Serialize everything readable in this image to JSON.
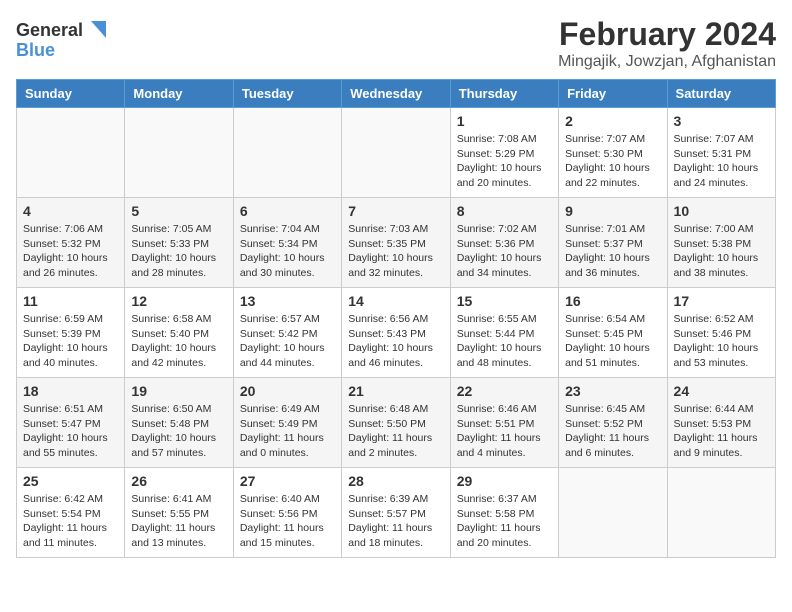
{
  "logo": {
    "text_general": "General",
    "text_blue": "Blue"
  },
  "title": "February 2024",
  "subtitle": "Mingajik, Jowzjan, Afghanistan",
  "days_of_week": [
    "Sunday",
    "Monday",
    "Tuesday",
    "Wednesday",
    "Thursday",
    "Friday",
    "Saturday"
  ],
  "weeks": [
    [
      {
        "day": "",
        "info": ""
      },
      {
        "day": "",
        "info": ""
      },
      {
        "day": "",
        "info": ""
      },
      {
        "day": "",
        "info": ""
      },
      {
        "day": "1",
        "info": "Sunrise: 7:08 AM\nSunset: 5:29 PM\nDaylight: 10 hours\nand 20 minutes."
      },
      {
        "day": "2",
        "info": "Sunrise: 7:07 AM\nSunset: 5:30 PM\nDaylight: 10 hours\nand 22 minutes."
      },
      {
        "day": "3",
        "info": "Sunrise: 7:07 AM\nSunset: 5:31 PM\nDaylight: 10 hours\nand 24 minutes."
      }
    ],
    [
      {
        "day": "4",
        "info": "Sunrise: 7:06 AM\nSunset: 5:32 PM\nDaylight: 10 hours\nand 26 minutes."
      },
      {
        "day": "5",
        "info": "Sunrise: 7:05 AM\nSunset: 5:33 PM\nDaylight: 10 hours\nand 28 minutes."
      },
      {
        "day": "6",
        "info": "Sunrise: 7:04 AM\nSunset: 5:34 PM\nDaylight: 10 hours\nand 30 minutes."
      },
      {
        "day": "7",
        "info": "Sunrise: 7:03 AM\nSunset: 5:35 PM\nDaylight: 10 hours\nand 32 minutes."
      },
      {
        "day": "8",
        "info": "Sunrise: 7:02 AM\nSunset: 5:36 PM\nDaylight: 10 hours\nand 34 minutes."
      },
      {
        "day": "9",
        "info": "Sunrise: 7:01 AM\nSunset: 5:37 PM\nDaylight: 10 hours\nand 36 minutes."
      },
      {
        "day": "10",
        "info": "Sunrise: 7:00 AM\nSunset: 5:38 PM\nDaylight: 10 hours\nand 38 minutes."
      }
    ],
    [
      {
        "day": "11",
        "info": "Sunrise: 6:59 AM\nSunset: 5:39 PM\nDaylight: 10 hours\nand 40 minutes."
      },
      {
        "day": "12",
        "info": "Sunrise: 6:58 AM\nSunset: 5:40 PM\nDaylight: 10 hours\nand 42 minutes."
      },
      {
        "day": "13",
        "info": "Sunrise: 6:57 AM\nSunset: 5:42 PM\nDaylight: 10 hours\nand 44 minutes."
      },
      {
        "day": "14",
        "info": "Sunrise: 6:56 AM\nSunset: 5:43 PM\nDaylight: 10 hours\nand 46 minutes."
      },
      {
        "day": "15",
        "info": "Sunrise: 6:55 AM\nSunset: 5:44 PM\nDaylight: 10 hours\nand 48 minutes."
      },
      {
        "day": "16",
        "info": "Sunrise: 6:54 AM\nSunset: 5:45 PM\nDaylight: 10 hours\nand 51 minutes."
      },
      {
        "day": "17",
        "info": "Sunrise: 6:52 AM\nSunset: 5:46 PM\nDaylight: 10 hours\nand 53 minutes."
      }
    ],
    [
      {
        "day": "18",
        "info": "Sunrise: 6:51 AM\nSunset: 5:47 PM\nDaylight: 10 hours\nand 55 minutes."
      },
      {
        "day": "19",
        "info": "Sunrise: 6:50 AM\nSunset: 5:48 PM\nDaylight: 10 hours\nand 57 minutes."
      },
      {
        "day": "20",
        "info": "Sunrise: 6:49 AM\nSunset: 5:49 PM\nDaylight: 11 hours\nand 0 minutes."
      },
      {
        "day": "21",
        "info": "Sunrise: 6:48 AM\nSunset: 5:50 PM\nDaylight: 11 hours\nand 2 minutes."
      },
      {
        "day": "22",
        "info": "Sunrise: 6:46 AM\nSunset: 5:51 PM\nDaylight: 11 hours\nand 4 minutes."
      },
      {
        "day": "23",
        "info": "Sunrise: 6:45 AM\nSunset: 5:52 PM\nDaylight: 11 hours\nand 6 minutes."
      },
      {
        "day": "24",
        "info": "Sunrise: 6:44 AM\nSunset: 5:53 PM\nDaylight: 11 hours\nand 9 minutes."
      }
    ],
    [
      {
        "day": "25",
        "info": "Sunrise: 6:42 AM\nSunset: 5:54 PM\nDaylight: 11 hours\nand 11 minutes."
      },
      {
        "day": "26",
        "info": "Sunrise: 6:41 AM\nSunset: 5:55 PM\nDaylight: 11 hours\nand 13 minutes."
      },
      {
        "day": "27",
        "info": "Sunrise: 6:40 AM\nSunset: 5:56 PM\nDaylight: 11 hours\nand 15 minutes."
      },
      {
        "day": "28",
        "info": "Sunrise: 6:39 AM\nSunset: 5:57 PM\nDaylight: 11 hours\nand 18 minutes."
      },
      {
        "day": "29",
        "info": "Sunrise: 6:37 AM\nSunset: 5:58 PM\nDaylight: 11 hours\nand 20 minutes."
      },
      {
        "day": "",
        "info": ""
      },
      {
        "day": "",
        "info": ""
      }
    ]
  ]
}
